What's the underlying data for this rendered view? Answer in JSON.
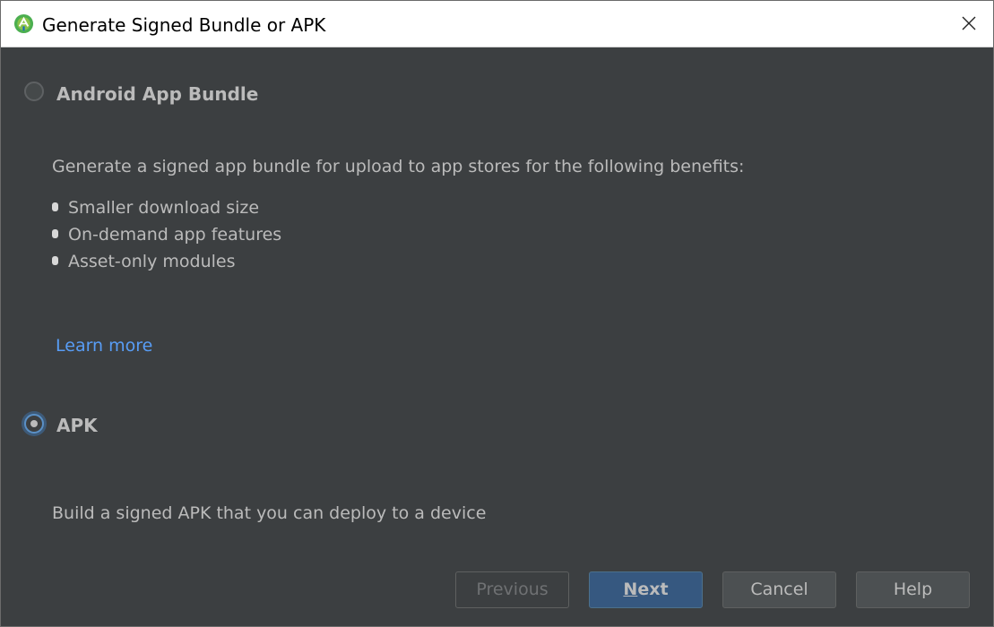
{
  "window": {
    "title": "Generate Signed Bundle or APK"
  },
  "icons": {
    "app": "android-studio-icon",
    "close": "close-icon"
  },
  "colors": {
    "background": "#3c3f41",
    "text": "#bbbbbb",
    "link": "#589df6",
    "primary_button": "#365880",
    "selected_radio": "#5a90c6"
  },
  "options": {
    "bundle": {
      "label": "Android App Bundle",
      "selected": false,
      "description": "Generate a signed app bundle for upload to app stores for the following benefits:",
      "benefits": [
        "Smaller download size",
        "On-demand app features",
        "Asset-only modules"
      ],
      "learn_more": "Learn more"
    },
    "apk": {
      "label": "APK",
      "selected": true,
      "description": "Build a signed APK that you can deploy to a device"
    }
  },
  "buttons": {
    "previous": {
      "label": "Previous",
      "enabled": false
    },
    "next": {
      "label_mnemonic": "N",
      "label_rest": "ext",
      "enabled": true
    },
    "cancel": {
      "label": "Cancel",
      "enabled": true
    },
    "help": {
      "label": "Help",
      "enabled": true
    }
  }
}
